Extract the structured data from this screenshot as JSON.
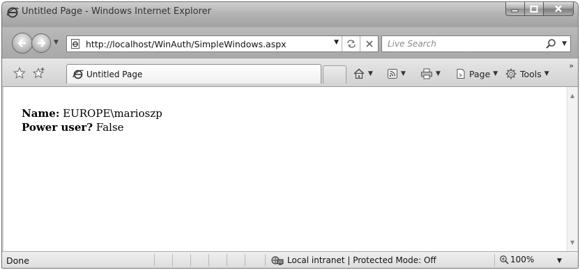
{
  "window": {
    "title": "Untitled Page - Windows Internet Explorer"
  },
  "address_bar": {
    "url": "http://localhost/WinAuth/SimpleWindows.aspx"
  },
  "search": {
    "placeholder": "Live Search"
  },
  "tab": {
    "label": "Untitled Page"
  },
  "command_bar": {
    "page_label": "Page",
    "tools_label": "Tools"
  },
  "content": {
    "name_label": "Name:",
    "name_value": "EUROPE\\marioszp",
    "power_label": "Power user?",
    "power_value": "False"
  },
  "status_bar": {
    "status": "Done",
    "zone": "Local intranet | Protected Mode: Off",
    "zoom": "100%"
  },
  "icons": [
    "ie-logo-icon",
    "minimize-icon",
    "maximize-icon",
    "close-icon",
    "back-icon",
    "forward-icon",
    "page-icon",
    "refresh-icon",
    "stop-icon",
    "search-icon",
    "favorites-star-icon",
    "add-favorites-icon",
    "home-icon",
    "feeds-icon",
    "print-icon",
    "page-menu-icon",
    "tools-gear-icon",
    "intranet-icon",
    "zoom-icon"
  ]
}
